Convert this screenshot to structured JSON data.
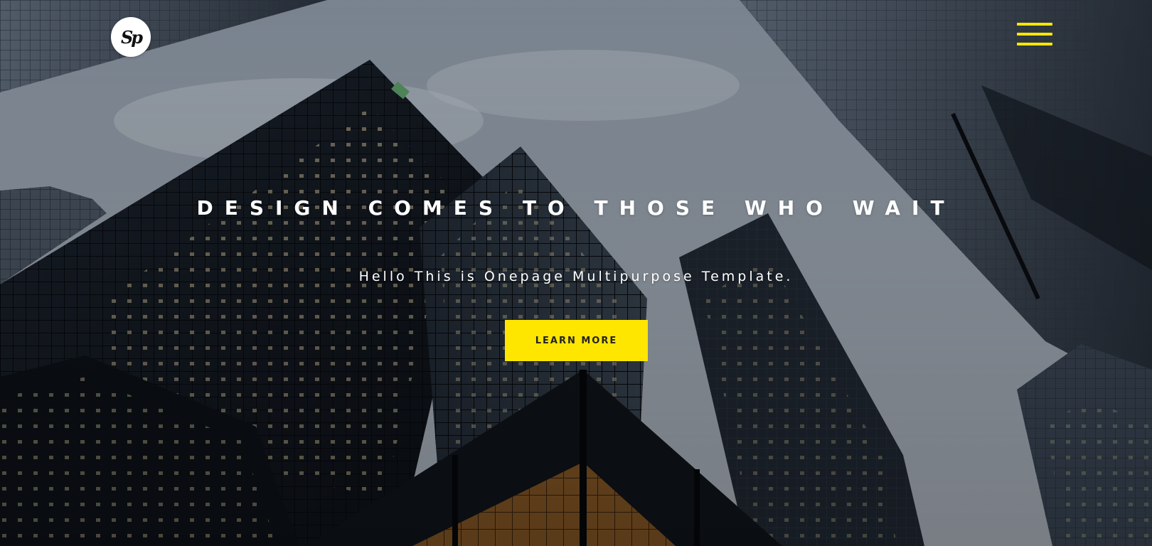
{
  "hero": {
    "headline": "DESIGN COMES TO THOSE WHO WAIT",
    "subheadline": "Hello This is Onepage Multipurpose Template.",
    "cta_label": "LEARN MORE"
  },
  "logo": {
    "text": "Sp"
  },
  "nav": {
    "menu_icon": "hamburger-menu-icon"
  },
  "colors": {
    "accent": "#ffe600",
    "text": "#ffffff",
    "button_text": "#222222"
  }
}
